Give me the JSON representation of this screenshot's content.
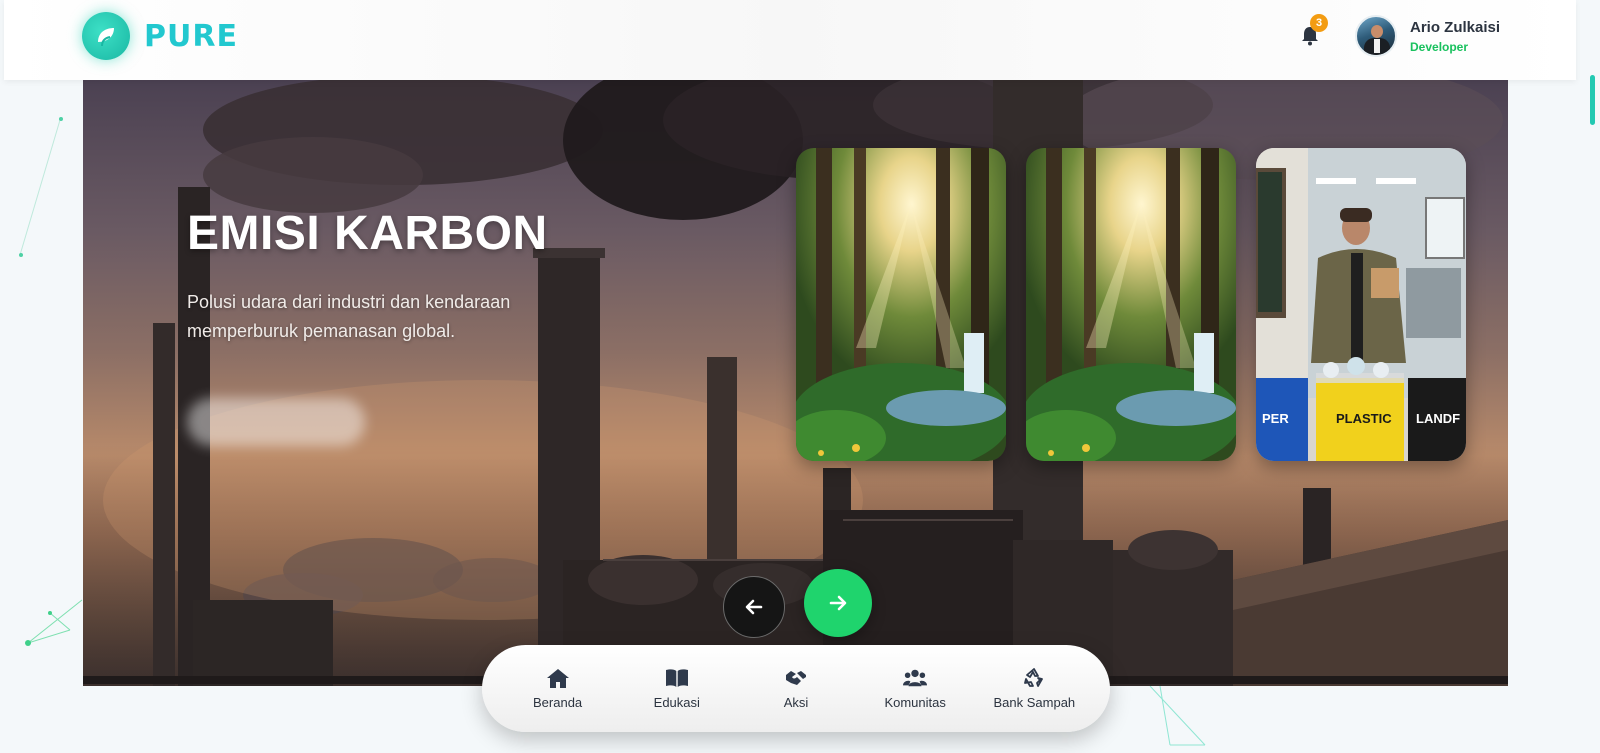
{
  "header": {
    "brand": "PURE",
    "notification_count": "3",
    "user": {
      "name": "Ario Zulkaisi",
      "role": "Developer"
    }
  },
  "hero": {
    "title": "EMISI KARBON",
    "description": "Polusi udara dari industri dan kendaraan memperburuk pemanasan global.",
    "cards": [
      {
        "label": "forest-waterfall"
      },
      {
        "label": "forest-waterfall"
      },
      {
        "label": "recycling-bins",
        "bin_labels": [
          "PER",
          "PLASTIC",
          "LANDF"
        ]
      }
    ]
  },
  "bottom_nav": {
    "items": [
      {
        "label": "Beranda",
        "icon": "home-icon"
      },
      {
        "label": "Edukasi",
        "icon": "book-icon"
      },
      {
        "label": "Aksi",
        "icon": "handshake-icon"
      },
      {
        "label": "Komunitas",
        "icon": "users-icon"
      },
      {
        "label": "Bank Sampah",
        "icon": "recycle-icon"
      }
    ]
  },
  "colors": {
    "brand": "#22c8cf",
    "accent_green": "#1fd46d",
    "role_green": "#19c15e",
    "badge": "#f39c12"
  }
}
